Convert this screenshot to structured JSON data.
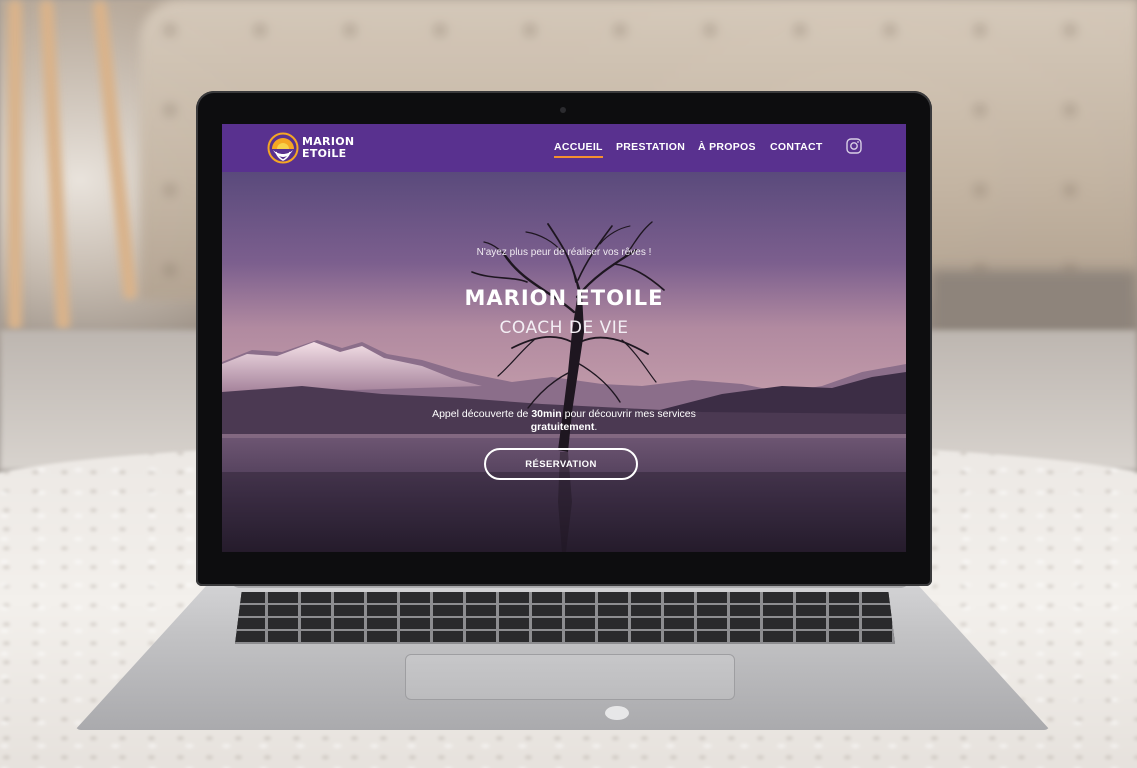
{
  "site": {
    "logo_line1": "MARION",
    "logo_line2": "ETOiLE",
    "logo_icon": "sunrise-hands-logo"
  },
  "nav": {
    "items": [
      {
        "label": "ACCUEIL",
        "active": true
      },
      {
        "label": "PRESTATION",
        "active": false
      },
      {
        "label": "À PROPOS",
        "active": false
      },
      {
        "label": "CONTACT",
        "active": false
      }
    ],
    "social_icon": "instagram-icon"
  },
  "hero": {
    "tagline": "N'ayez plus peur de réaliser vos rêves !",
    "title": "MARION ETOILE",
    "subtitle": "COACH DE VIE",
    "desc_pre": "Appel découverte de ",
    "desc_bold1": "30min",
    "desc_mid": " pour découvrir mes services",
    "desc_bold2": "gratuitement",
    "desc_end": ".",
    "cta_label": "RÉSERVATION"
  },
  "colors": {
    "navbar": "#59318f",
    "accent": "#f5902e",
    "logo_orange": "#f5a623",
    "logo_yellow": "#f8d24a"
  }
}
